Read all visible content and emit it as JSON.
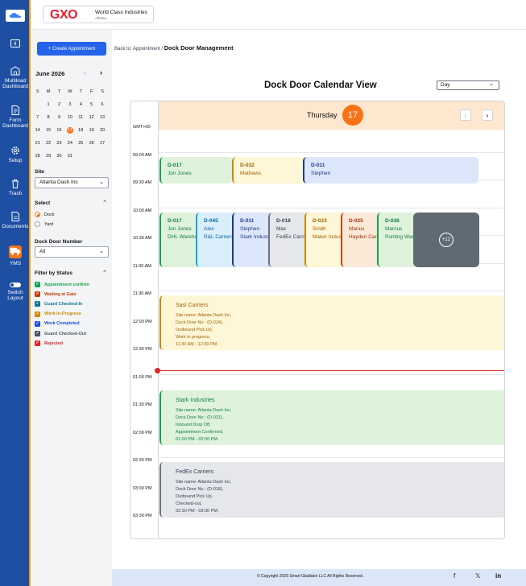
{
  "nav": {
    "items": [
      {
        "label": "Multiload Dashboard",
        "icon": "building-icon"
      },
      {
        "label": "Form Dashboard",
        "icon": "document-icon"
      },
      {
        "label": "Setup",
        "icon": "gear-icon"
      },
      {
        "label": "Trash",
        "icon": "trash-icon"
      },
      {
        "label": "Documents",
        "icon": "documents-icon"
      },
      {
        "label": "YMS",
        "icon": "truck-icon"
      },
      {
        "label": "Switch Layout",
        "icon": "toggle-icon"
      }
    ]
  },
  "brand": {
    "logo_text": "GXO",
    "name": "World Class Industries",
    "sub": "Atlanta"
  },
  "panel": {
    "create_label": "+ Create Appointment",
    "month": "June 2026",
    "weekdays": [
      "S",
      "M",
      "T",
      "W",
      "T",
      "F",
      "S"
    ],
    "weeks": [
      [
        "",
        "1",
        "2",
        "3",
        "4",
        "5",
        "6"
      ],
      [
        "7",
        "8",
        "9",
        "10",
        "11",
        "12",
        "13"
      ],
      [
        "14",
        "15",
        "16",
        "17",
        "18",
        "19",
        "20"
      ],
      [
        "21",
        "22",
        "23",
        "24",
        "25",
        "26",
        "27"
      ],
      [
        "28",
        "29",
        "30",
        "31",
        "",
        "",
        ""
      ]
    ],
    "today": "17",
    "site_label": "Site",
    "site_value": "Atlanta Dash Inc",
    "select_label": "Select",
    "radio_options": [
      "Dock",
      "Yard"
    ],
    "dock_label": "Dock Door Number",
    "dock_value": "All",
    "filter_label": "Filter by Status",
    "statuses": [
      {
        "label": "Appointment confirm",
        "color": "#16a34a"
      },
      {
        "label": "Waiting at Gate",
        "color": "#c2410c"
      },
      {
        "label": "Guard Checked-In",
        "color": "#0e7490"
      },
      {
        "label": "Work In-Progress",
        "color": "#ca8a04"
      },
      {
        "label": "Work Completed",
        "color": "#1d4ed8"
      },
      {
        "label": "Guard Checked-Out",
        "color": "#4b5563"
      },
      {
        "label": "Rejected",
        "color": "#dc2626"
      }
    ]
  },
  "main": {
    "crumb_prefix": "Back to: Appointment /",
    "crumb_current": "Dock Door Management",
    "title": "Dock Door Calendar View",
    "view_select": "Day",
    "day_name": "Thursday",
    "day_num": "17",
    "prev": "‹",
    "next": "›"
  },
  "times": [
    "GMT+00",
    "09:00 AM",
    "09:30 AM",
    "10:00 AM",
    "10:30 AM",
    "11:00 AM",
    "11:30 AM",
    "12:00 PM",
    "12:30 PM",
    "01:00 PM",
    "01:30 PM",
    "02:00 PM",
    "02:30 PM",
    "03:00 PM",
    "03:30 PM"
  ],
  "events_row1": [
    {
      "id": "D-017",
      "name": "Jon Jones",
      "cls": "green"
    },
    {
      "id": "D-032",
      "name": "Mathews",
      "cls": "yellow"
    },
    {
      "id": "D-011",
      "name": "Stephen",
      "cls": "blue"
    }
  ],
  "events_row2": [
    {
      "id": "D-017",
      "name": "Jon Jones",
      "extra": "DHL Warehouse",
      "cls": "green"
    },
    {
      "id": "D-045",
      "name": "Alex",
      "extra": "R&L Carriers",
      "cls": "cyan"
    },
    {
      "id": "D-011",
      "name": "Stephen",
      "extra": "Stark Industries",
      "cls": "blue"
    },
    {
      "id": "D-018",
      "name": "Max",
      "extra": "FedEx Carriers",
      "cls": "grey"
    },
    {
      "id": "D-023",
      "name": "Smith",
      "extra": "Maker Industries",
      "cls": "yellow"
    },
    {
      "id": "D-025",
      "name": "Manus",
      "extra": "Hayden Carriers",
      "cls": "orange"
    },
    {
      "id": "D-038",
      "name": "Marcus",
      "extra": "Ponting Warehouse",
      "cls": "green"
    }
  ],
  "more_label": "+12",
  "big_events": [
    {
      "title": "Sasi Carriers",
      "cls": "yellow",
      "lines": [
        "Site name: Atlanta Dash Inc,",
        "Dock Door No : (D-024),",
        "Outbound Pick Up,",
        "Work in progress,",
        "11:30 AM - 12:30 PM."
      ]
    },
    {
      "title": "Stark Industries",
      "cls": "green",
      "lines": [
        "Site name: Atlanta Dash Inc,",
        "Dock Door No : (D-031),",
        "Inbound Drop Off,",
        "Appointment Confirmed,",
        "01:00 PM - 02:00 PM."
      ]
    },
    {
      "title": "FedEx Carriers",
      "cls": "grey",
      "lines": [
        "Site name: Atlanta Dash Inc,",
        "Dock Door No : (D-018),",
        "Outbound Pick Up,",
        "Checked-out,",
        "02:30 PM - 03:30 PM."
      ]
    }
  ],
  "footer": {
    "copyright": "© Copyright 2026 Smart Gladiator LLC All Rights Reserved.",
    "social": [
      "f",
      "𝕏",
      "in"
    ]
  }
}
